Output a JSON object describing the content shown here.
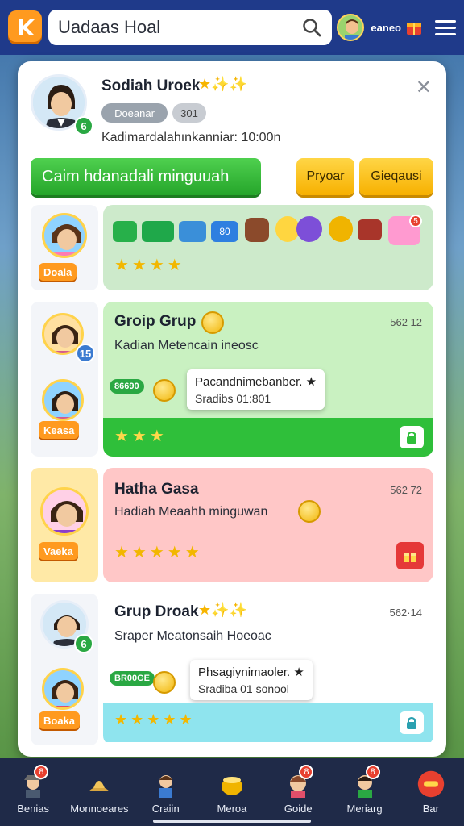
{
  "topbar": {
    "search_text": "Uadaas Hoal",
    "coins_label": "eaneo"
  },
  "profile": {
    "name": "Sodiah Uroek",
    "name_stars": "★✨✨",
    "pill1": "Doeanar",
    "pill2": "301",
    "subtitle": "Kadimardalahınkanniar: 10:00n",
    "level_badge": "6",
    "primary_button": "Caim hdanadali minguuah",
    "btn_yellow1": "Pryoar",
    "btn_yellow2": "Gieqausi"
  },
  "rows": [
    {
      "tag": "Doala",
      "stars": "★★★★",
      "items": [
        "",
        "",
        "",
        "80"
      ],
      "corner_badge": "5"
    },
    {
      "title": "Groip Grup",
      "count": "562 12",
      "subtitle": "Kadian Metencain ineosc",
      "badge": "15",
      "green_pill": "86690",
      "popover_line1": "Pacandnimebanber. ★",
      "popover_line2": "Sradibs 01:801",
      "tag": "Keasa",
      "stars": "★★★"
    },
    {
      "title": "Hatha Gasa",
      "count": "562 72",
      "subtitle": "Hadiah Meaahh minguwan",
      "tag": "Vaeka",
      "stars": "★★★★★"
    },
    {
      "title": "Grup Droak",
      "title_stars": "★✨✨",
      "count": "562·14",
      "subtitle": "Sraper Meatonsaih Hoeoac",
      "badge": "6",
      "green_pill": "BR00GE",
      "popover_line1": "Phsagiynimaoler. ★",
      "popover_line2": "Sradiba 01 sonool",
      "tag": "Boaka",
      "stars": "★★★★★"
    }
  ],
  "bottom_nav": [
    {
      "label": "Benias",
      "badge": "8"
    },
    {
      "label": "Monnoeares",
      "badge": ""
    },
    {
      "label": "Craiin",
      "badge": ""
    },
    {
      "label": "Meroa",
      "badge": ""
    },
    {
      "label": "Goide",
      "badge": "8"
    },
    {
      "label": "Meriarg",
      "badge": "8"
    },
    {
      "label": "Bar",
      "badge": ""
    }
  ],
  "colors": {
    "topbar": "#1f3a8a",
    "green": "#2aa843",
    "yellow": "#f7b000",
    "row2_bg": "#c9f1c1",
    "row3_bg": "#ffc7c7",
    "row4_footer": "#8fe4ee"
  }
}
